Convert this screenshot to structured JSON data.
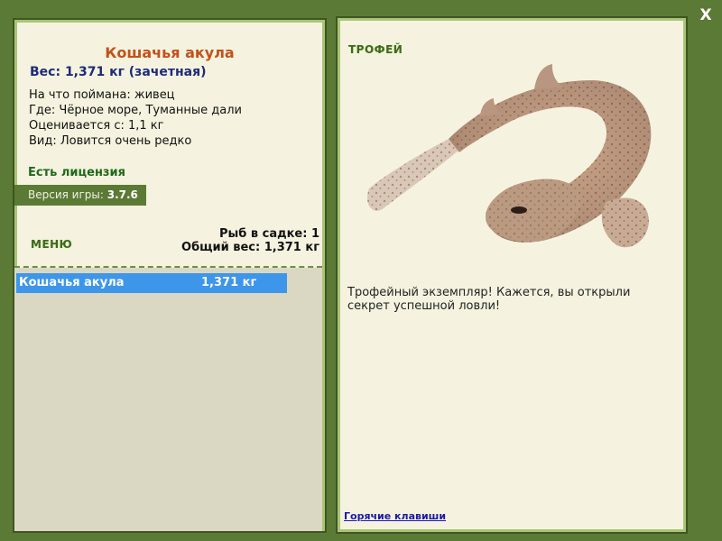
{
  "window": {
    "close_label": "X"
  },
  "fish": {
    "name": "Кошачья акула",
    "weight_line": "Вес: 1,371 кг (зачетная)",
    "info": [
      "На что поймана: живец",
      "Где: Чёрное море, Туманные дали",
      "Оценивается с: 1,1 кг",
      "Вид: Ловится очень редко"
    ]
  },
  "license": "Есть лицензия",
  "version": {
    "label": "Версия игры:",
    "value": "3.7.6"
  },
  "menu_label": "МЕНЮ",
  "keep": {
    "count_line": "Рыб в садке: 1",
    "total_line": "Общий вес: 1,371 кг"
  },
  "catch_list": [
    {
      "name": "Кошачья акула",
      "weight": "1,371 кг"
    }
  ],
  "trophy": {
    "label": "ТРОФЕЙ",
    "image_icon": "catshark-photo",
    "text": "Трофейный экземпляр! Кажется, вы открыли секрет успешной ловли!"
  },
  "hotkeys_link": "Горячие клавиши",
  "colors": {
    "frame": "#5b7a36",
    "panel": "#f5f3df",
    "fish_name": "#c4501a",
    "selected_row": "#3d96ea"
  }
}
